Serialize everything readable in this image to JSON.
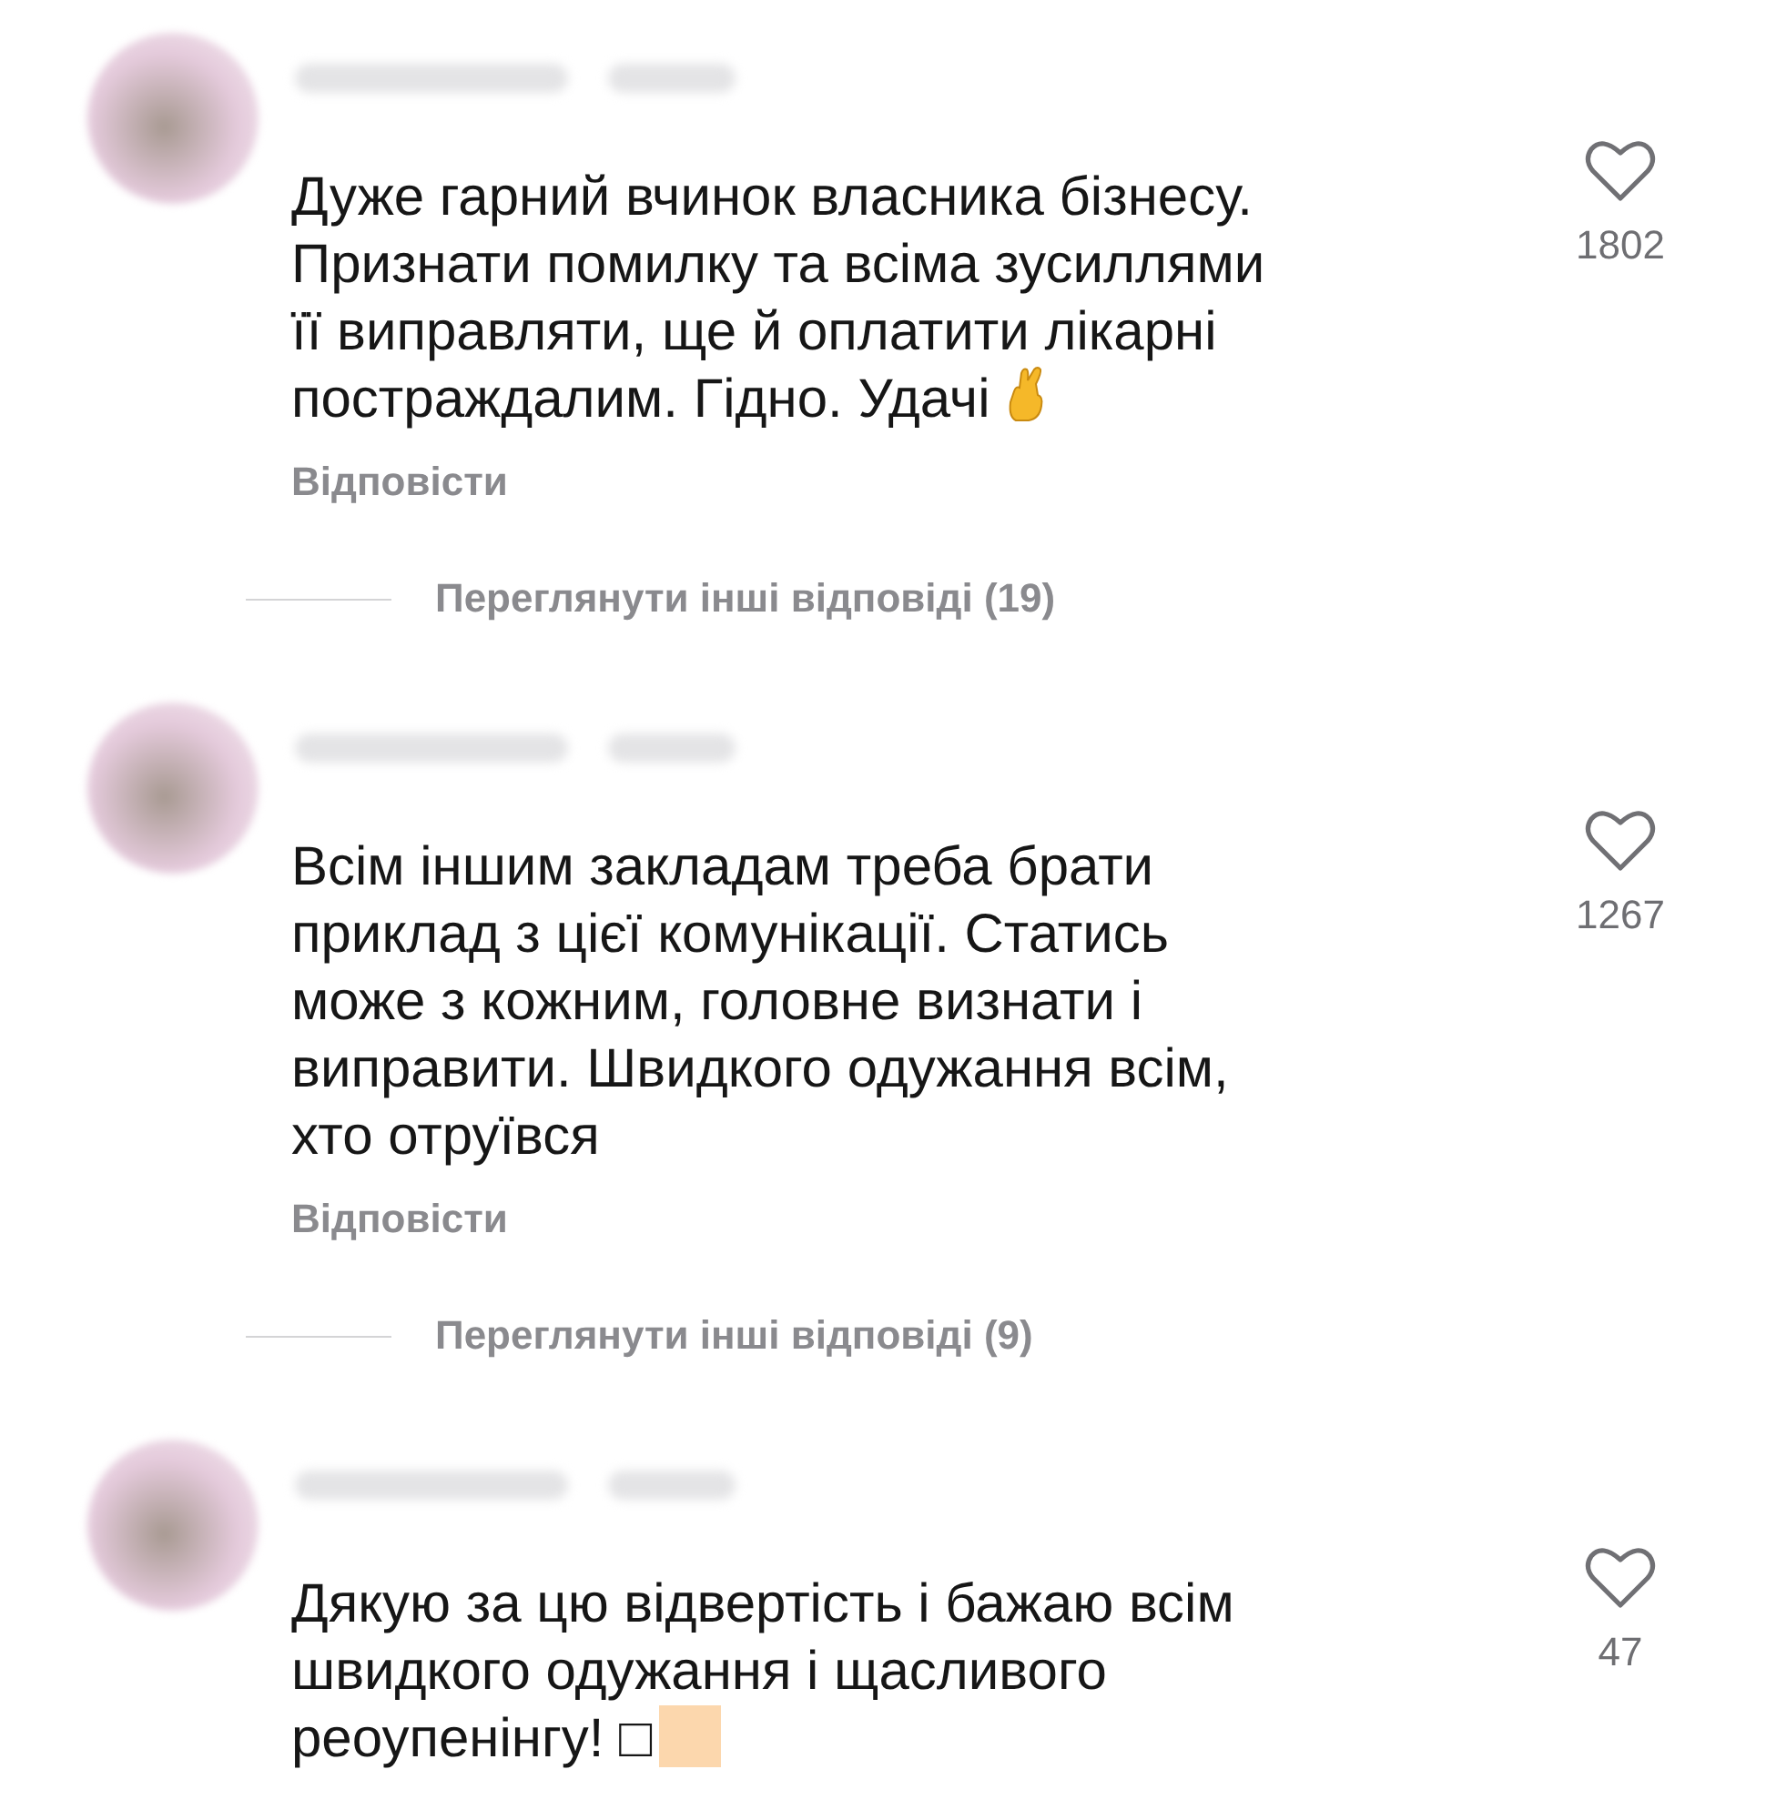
{
  "comments": [
    {
      "text_lines": [
        "Дуже гарний вчинок власника бізнесу.",
        "Признати помилку та всіма зусиллями",
        "її виправляти, ще й оплатити лікарні",
        "постраждалим. Гідно. Удачі"
      ],
      "emoji": {
        "kind": "hand"
      },
      "likes": "1802",
      "reply_label": "Відповісти",
      "more_replies": "Переглянути інші відповіді (19)"
    },
    {
      "text_lines": [
        "Всім іншим закладам треба брати",
        "приклад з цієї комунікації. Статись",
        "може з кожним, головне визнати і",
        "виправити. Швидкого одужання всім,",
        "хто отруївся"
      ],
      "likes": "1267",
      "reply_label": "Відповісти",
      "more_replies": "Переглянути інші відповіді (9)"
    },
    {
      "text_lines": [
        "Дякую за цю відвертість і бажаю всім",
        "швидкого одужання і щасливого",
        "реоупенінгу! □"
      ],
      "emoji": {
        "kind": "swatch"
      },
      "likes": "47"
    }
  ]
}
